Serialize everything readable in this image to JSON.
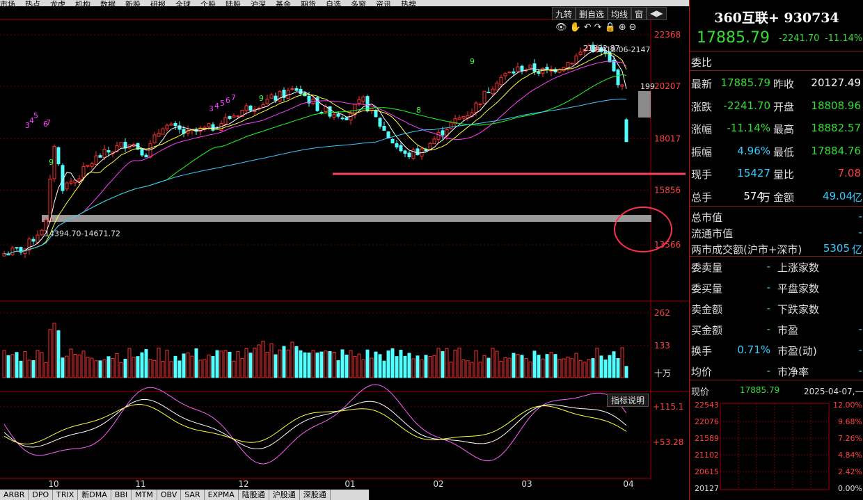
{
  "menu": {
    "items": [
      "市场",
      "热点",
      "龙虎",
      "机构",
      "数据",
      "新股",
      "研报",
      "全球",
      "个股",
      "陆股",
      "沪深",
      "基金",
      "期货",
      "自选",
      "多窗",
      "资讯",
      "热搜"
    ]
  },
  "toolbar": {
    "items": [
      "九转",
      "删自选",
      "均线",
      "窗",
      "◀▶"
    ]
  },
  "toolbar_icons": [
    "👁",
    "✋",
    "↶",
    "↷",
    "🔒",
    "⊕",
    "⊖"
  ],
  "indicator_button": "指标说明",
  "bottom_tabs": [
    "ARBR",
    "DPO",
    "TRIX",
    "新DMA",
    "BBI",
    "MTM",
    "OBV",
    "SAR",
    "EXPMA",
    "陆股通",
    "沪股通",
    "深股通"
  ],
  "price_axis": [
    "22368",
    "20207",
    "18017",
    "15856",
    "13566"
  ],
  "volume_axis": [
    "262",
    "133",
    "十万"
  ],
  "indicator_axis": [
    "+115.1",
    "+53.28"
  ],
  "x_axis": [
    "10",
    "11",
    "12",
    "01",
    "02",
    "03",
    "04"
  ],
  "annotations": {
    "support_band": "14394.70-14671.72",
    "peak_label": "21822.87",
    "peak_range": "21418.06-2147",
    "right_mark": "199"
  },
  "td_counts": {
    "series1": [
      "3",
      "4",
      "5",
      "6",
      "7"
    ],
    "nines": [
      "9",
      "8",
      "9"
    ]
  },
  "stock": {
    "name": "360互联+ 930734",
    "price": "17885.79",
    "change": "-2241.70",
    "change_pct": "-11.14%"
  },
  "quote": {
    "weibi_label": "委比",
    "rows": [
      {
        "l1": "最新",
        "v1": "17885.79",
        "c1": "green",
        "l2": "昨收",
        "v2": "20127.49",
        "c2": "white"
      },
      {
        "l1": "涨跌",
        "v1": "-2241.70",
        "c1": "green",
        "l2": "开盘",
        "v2": "18808.96",
        "c2": "green"
      },
      {
        "l1": "涨幅",
        "v1": "-11.14%",
        "c1": "green",
        "l2": "最高",
        "v2": "18882.57",
        "c2": "green"
      },
      {
        "l1": "振幅",
        "v1": "4.96%",
        "c1": "cyan",
        "l2": "最低",
        "v2": "17884.76",
        "c2": "green"
      },
      {
        "l1": "现手",
        "v1": "15427",
        "c1": "cyan",
        "l2": "量比",
        "v2": "7.08",
        "c2": "red"
      },
      {
        "l1": "总手",
        "v1": "574",
        "c1": "white",
        "u1": "万",
        "l2": "金额",
        "v2": "49.04",
        "c2": "cyan",
        "u2": "亿"
      }
    ],
    "market": [
      {
        "label": "总市值",
        "value": "-"
      },
      {
        "label": "流通市值",
        "value": "-"
      },
      {
        "label": "两市成交额(沪市+深市)",
        "value": "5305",
        "unit": "亿"
      }
    ],
    "stats": [
      {
        "l1": "委卖量",
        "v1": "-",
        "l2": "上涨家数",
        "v2": ""
      },
      {
        "l1": "委买量",
        "v1": "-",
        "l2": "平盘家数",
        "v2": ""
      },
      {
        "l1": "卖金额",
        "v1": "-",
        "l2": "下跌家数",
        "v2": ""
      },
      {
        "l1": "买金额",
        "v1": "-",
        "l2": "市盈",
        "v2": "-"
      },
      {
        "l1": "换手",
        "v1": "0.71%",
        "l2": "市盈(动)",
        "v2": "-"
      },
      {
        "l1": "均价",
        "v1": "-",
        "l2": "市净率",
        "v2": "-"
      }
    ]
  },
  "mini": {
    "label": "现价",
    "price": "17885.79",
    "date": "2025-04-07,一",
    "left_axis": [
      "22543",
      "22076",
      "21589",
      "21102",
      "20615",
      "20127"
    ],
    "right_axis": [
      "12.00%",
      "9.68%",
      "7.26%",
      "4.84%",
      "2.42%",
      "0.00%"
    ]
  },
  "colors": {
    "up": "#ff3030",
    "down": "#54ffff",
    "ma5": "#ffffff",
    "ma10": "#ffff40",
    "ma20": "#ff40ff",
    "ma60": "#20ff20",
    "ma120": "#40c8ff",
    "grid": "#6a0000"
  },
  "chart_data": {
    "type": "candlestick",
    "price_ylim": [
      12500,
      23200
    ],
    "x_months": [
      "10",
      "11",
      "12",
      "01",
      "02",
      "03",
      "04"
    ],
    "last_close": 17885.79,
    "prev_close": 20127.49,
    "support_level": 17000,
    "band": [
      14394.7,
      14671.72
    ]
  }
}
